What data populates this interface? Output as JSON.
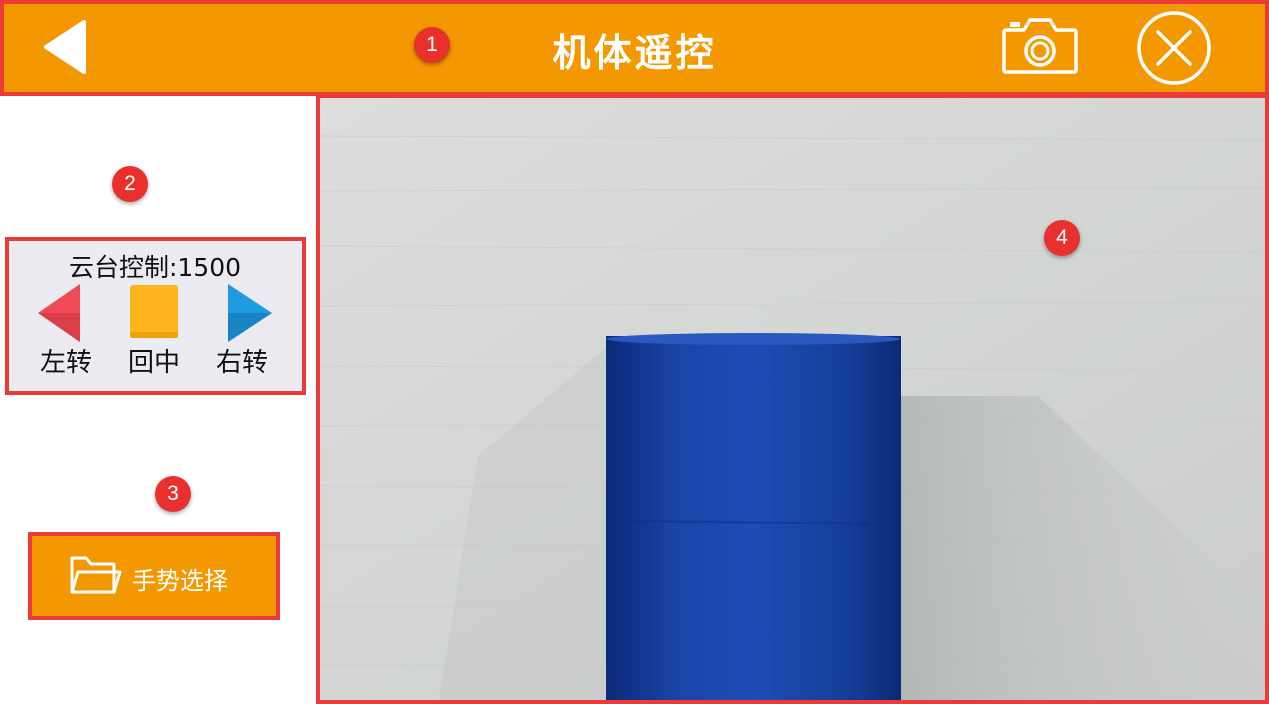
{
  "header": {
    "title": "机体遥控",
    "back_icon": "back-triangle-icon",
    "camera_icon": "camera-icon",
    "close_icon": "close-circle-icon",
    "background_color": "#f39800"
  },
  "gimbal": {
    "title": "云台控制:1500",
    "buttons": [
      {
        "label": "左转",
        "icon": "left-triangle-icon",
        "color": "#f04a56"
      },
      {
        "label": "回中",
        "icon": "center-square-icon",
        "color": "#ffb41e"
      },
      {
        "label": "右转",
        "icon": "right-triangle-icon",
        "color": "#1f9be0"
      }
    ]
  },
  "gesture": {
    "label": "手势选择",
    "icon": "folder-icon"
  },
  "markers": [
    "1",
    "2",
    "3",
    "4"
  ],
  "colors": {
    "accent": "#f39800",
    "highlight": "#ea3a3a",
    "marker": "#e8302c"
  }
}
